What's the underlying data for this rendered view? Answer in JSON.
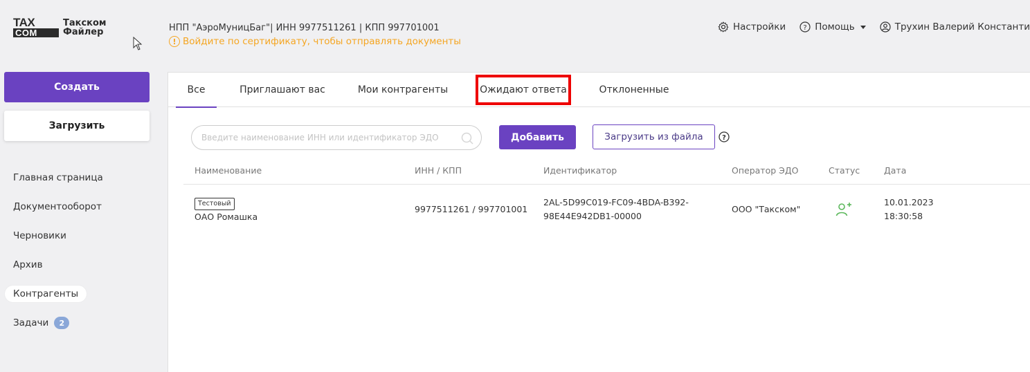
{
  "logo": {
    "line1": "TAX",
    "line2": "COM",
    "text1": "Такском",
    "text2": "Файлер"
  },
  "header": {
    "org": "НПП \"АэроМуницБаг\"| ИНН 9977511261 | КПП 997701001",
    "warning": "Войдите по сертификату, чтобы отправлять документы",
    "settings": "Настройки",
    "help": "Помощь",
    "user": "Трухин Валерий Константи"
  },
  "sidebar": {
    "create": "Создать",
    "upload": "Загрузить",
    "items": [
      {
        "label": "Главная страница"
      },
      {
        "label": "Документооборот"
      },
      {
        "label": "Черновики"
      },
      {
        "label": "Архив"
      },
      {
        "label": "Контрагенты"
      },
      {
        "label": "Задачи",
        "badge": "2"
      }
    ]
  },
  "tabs": [
    "Все",
    "Приглашают вас",
    "Мои контрагенты",
    "Ожидают ответа",
    "Отклоненные"
  ],
  "search": {
    "placeholder": "Введите наименование ИНН или идентификатор ЭДО"
  },
  "actions": {
    "add": "Добавить",
    "from_file": "Загрузить из файла"
  },
  "table": {
    "headers": [
      "Наименование",
      "ИНН / КПП",
      "Идентификатор",
      "Оператор ЭДО",
      "Статус",
      "Дата"
    ],
    "rows": [
      {
        "badge": "Тестовый",
        "name": "ОАО Ромашка",
        "inn_kpp": "9977511261 / 997701001",
        "id_line1": "2AL-5D99C019-FC09-4BDA-B392-",
        "id_line2": "98E44E942DB1-00000",
        "operator": "ООО \"Такском\"",
        "date": "10.01.2023",
        "time": "18:30:58"
      }
    ]
  },
  "colors": {
    "accent": "#6a42c1",
    "warning": "#f5a623",
    "status": "#5cb85c",
    "highlight": "#e00000"
  }
}
